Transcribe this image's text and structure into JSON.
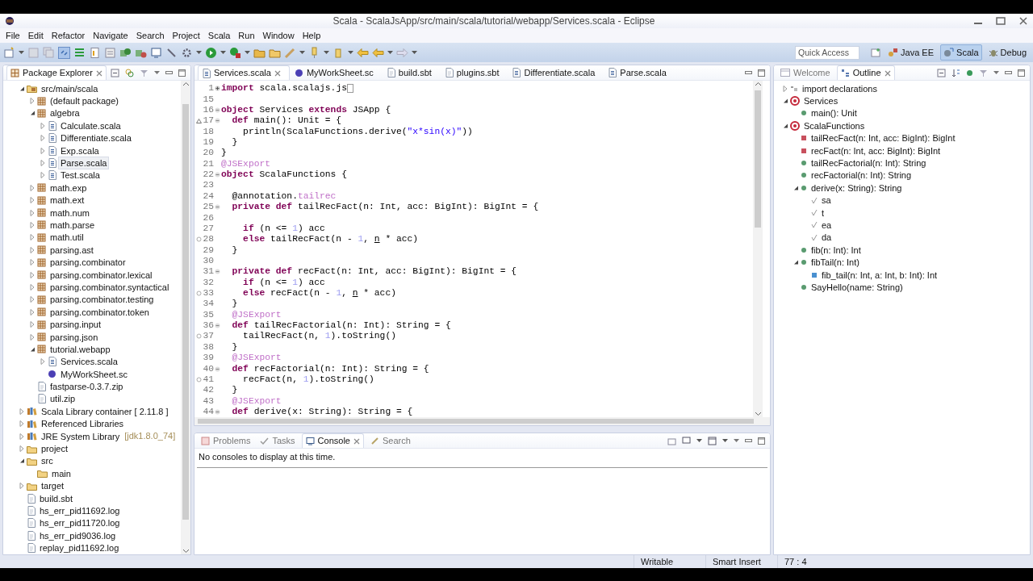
{
  "window": {
    "title": "Scala - ScalaJsApp/src/main/scala/tutorial/webapp/Services.scala - Eclipse"
  },
  "menu": [
    "File",
    "Edit",
    "Refactor",
    "Navigate",
    "Search",
    "Project",
    "Scala",
    "Run",
    "Window",
    "Help"
  ],
  "quick_access": {
    "placeholder": "Quick Access"
  },
  "perspectives": [
    {
      "label": "Java EE",
      "kind": "javaee",
      "selected": false
    },
    {
      "label": "Scala",
      "kind": "scala",
      "selected": true
    },
    {
      "label": "Debug",
      "kind": "debug",
      "selected": false
    }
  ],
  "package_explorer": {
    "title": "Package Explorer",
    "items": [
      {
        "label": "src/main/scala",
        "kind": "source-folder",
        "expanded": true,
        "selected": false,
        "children": [
          {
            "label": "(default package)",
            "kind": "package",
            "expanded": false,
            "selected": false
          },
          {
            "label": "algebra",
            "kind": "package",
            "expanded": true,
            "selected": false,
            "children": [
              {
                "label": "Calculate.scala",
                "kind": "scala-file",
                "expanded": false,
                "selected": false
              },
              {
                "label": "Differentiate.scala",
                "kind": "scala-file",
                "expanded": false,
                "selected": false
              },
              {
                "label": "Exp.scala",
                "kind": "scala-file",
                "expanded": false,
                "selected": false
              },
              {
                "label": "Parse.scala",
                "kind": "scala-file",
                "expanded": false,
                "selected": true
              },
              {
                "label": "Test.scala",
                "kind": "scala-file",
                "expanded": false,
                "selected": false
              }
            ]
          },
          {
            "label": "math.exp",
            "kind": "package",
            "expanded": false,
            "selected": false
          },
          {
            "label": "math.ext",
            "kind": "package",
            "expanded": false,
            "selected": false
          },
          {
            "label": "math.num",
            "kind": "package",
            "expanded": false,
            "selected": false
          },
          {
            "label": "math.parse",
            "kind": "package",
            "expanded": false,
            "selected": false
          },
          {
            "label": "math.util",
            "kind": "package",
            "expanded": false,
            "selected": false
          },
          {
            "label": "parsing.ast",
            "kind": "package",
            "expanded": false,
            "selected": false
          },
          {
            "label": "parsing.combinator",
            "kind": "package",
            "expanded": false,
            "selected": false
          },
          {
            "label": "parsing.combinator.lexical",
            "kind": "package",
            "expanded": false,
            "selected": false
          },
          {
            "label": "parsing.combinator.syntactical",
            "kind": "package",
            "expanded": false,
            "selected": false
          },
          {
            "label": "parsing.combinator.testing",
            "kind": "package",
            "expanded": false,
            "selected": false
          },
          {
            "label": "parsing.combinator.token",
            "kind": "package",
            "expanded": false,
            "selected": false
          },
          {
            "label": "parsing.input",
            "kind": "package",
            "expanded": false,
            "selected": false
          },
          {
            "label": "parsing.json",
            "kind": "package",
            "expanded": false,
            "selected": false
          },
          {
            "label": "tutorial.webapp",
            "kind": "package",
            "expanded": true,
            "selected": false,
            "children": [
              {
                "label": "Services.scala",
                "kind": "scala-file",
                "expanded": false,
                "selected": false
              },
              {
                "label": "MyWorkSheet.sc",
                "kind": "worksheet",
                "selected": false
              }
            ]
          },
          {
            "label": "fastparse-0.3.7.zip",
            "kind": "file",
            "selected": false
          },
          {
            "label": "util.zip",
            "kind": "file",
            "selected": false
          }
        ]
      },
      {
        "label": "Scala Library container [ 2.11.8 ]",
        "kind": "library",
        "expanded": false,
        "selected": false
      },
      {
        "label": "Referenced Libraries",
        "kind": "library",
        "expanded": false,
        "selected": false
      },
      {
        "label": "JRE System Library",
        "detail": "[jdk1.8.0_74]",
        "kind": "library",
        "expanded": false,
        "selected": false
      },
      {
        "label": "project",
        "kind": "folder",
        "expanded": false,
        "selected": false
      },
      {
        "label": "src",
        "kind": "folder",
        "expanded": true,
        "selected": false,
        "children": [
          {
            "label": "main",
            "kind": "folder",
            "selected": false
          }
        ]
      },
      {
        "label": "target",
        "kind": "folder",
        "expanded": false,
        "selected": false
      },
      {
        "label": "build.sbt",
        "kind": "file",
        "selected": false
      },
      {
        "label": "hs_err_pid11692.log",
        "kind": "file",
        "selected": false
      },
      {
        "label": "hs_err_pid11720.log",
        "kind": "file",
        "selected": false
      },
      {
        "label": "hs_err_pid9036.log",
        "kind": "file",
        "selected": false
      },
      {
        "label": "replay_pid11692.log",
        "kind": "file",
        "selected": false
      }
    ]
  },
  "editor": {
    "tabs": [
      {
        "label": "Services.scala",
        "kind": "scala-file",
        "selected": true
      },
      {
        "label": "MyWorkSheet.sc",
        "kind": "worksheet",
        "selected": false
      },
      {
        "label": "build.sbt",
        "kind": "file",
        "selected": false
      },
      {
        "label": "plugins.sbt",
        "kind": "file",
        "selected": false
      },
      {
        "label": "Differentiate.scala",
        "kind": "scala-file",
        "selected": false
      },
      {
        "label": "Parse.scala",
        "kind": "scala-file",
        "selected": false
      }
    ],
    "lines": [
      {
        "number": "1",
        "folded": true,
        "tokens": [
          {
            "kind": "keyword",
            "text": "import"
          },
          {
            "kind": "plain",
            "text": " scala.scalajs.js"
          }
        ]
      },
      {
        "number": "15"
      },
      {
        "number": "16",
        "folded": false,
        "tokens": [
          {
            "kind": "keyword",
            "text": "object"
          },
          {
            "kind": "plain",
            "text": " Services "
          },
          {
            "kind": "keyword",
            "text": "extends"
          },
          {
            "kind": "plain",
            "text": " JSApp {"
          }
        ]
      },
      {
        "number": "17",
        "folded": false,
        "overrides": true,
        "tokens": [
          {
            "kind": "keyword",
            "text": "  def"
          },
          {
            "kind": "plain",
            "text": " main(): Unit = {"
          }
        ]
      },
      {
        "number": "18",
        "tokens": [
          {
            "kind": "plain",
            "text": "    println(ScalaFunctions.derive("
          },
          {
            "kind": "string",
            "text": "\"x*sin(x)\""
          },
          {
            "kind": "plain",
            "text": "))"
          }
        ]
      },
      {
        "number": "19",
        "tokens": [
          {
            "kind": "plain",
            "text": "  }"
          }
        ]
      },
      {
        "number": "20",
        "tokens": [
          {
            "kind": "plain",
            "text": "}"
          }
        ]
      },
      {
        "number": "21",
        "tokens": [
          {
            "kind": "annotation",
            "text": "@JSExport"
          }
        ]
      },
      {
        "number": "22",
        "folded": false,
        "tokens": [
          {
            "kind": "keyword",
            "text": "object"
          },
          {
            "kind": "plain",
            "text": " ScalaFunctions {"
          }
        ]
      },
      {
        "number": "23"
      },
      {
        "number": "24",
        "tokens": [
          {
            "kind": "plain",
            "text": "  @annotation."
          },
          {
            "kind": "annotation",
            "text": "tailrec"
          }
        ]
      },
      {
        "number": "25",
        "folded": false,
        "tokens": [
          {
            "kind": "keyword",
            "text": "  private def"
          },
          {
            "kind": "plain",
            "text": " tailRecFact(n: Int, acc: BigInt): BigInt = {"
          }
        ]
      },
      {
        "number": "26"
      },
      {
        "number": "27",
        "tokens": [
          {
            "kind": "keyword",
            "text": "    if"
          },
          {
            "kind": "plain",
            "text": " (n <= "
          },
          {
            "kind": "number",
            "text": "1"
          },
          {
            "kind": "plain",
            "text": ") acc"
          }
        ]
      },
      {
        "number": "28",
        "recursive_call": true,
        "tokens": [
          {
            "kind": "keyword",
            "text": "    else"
          },
          {
            "kind": "plain",
            "text": " tailRecFact(n - "
          },
          {
            "kind": "number",
            "text": "1"
          },
          {
            "kind": "plain",
            "text": ", "
          },
          {
            "kind": "implicit",
            "text": "n"
          },
          {
            "kind": "plain",
            "text": " * acc)"
          }
        ]
      },
      {
        "number": "29",
        "tokens": [
          {
            "kind": "plain",
            "text": "  }"
          }
        ]
      },
      {
        "number": "30"
      },
      {
        "number": "31",
        "folded": false,
        "tokens": [
          {
            "kind": "keyword",
            "text": "  private def"
          },
          {
            "kind": "plain",
            "text": " recFact(n: Int, acc: BigInt): BigInt = {"
          }
        ]
      },
      {
        "number": "32",
        "tokens": [
          {
            "kind": "keyword",
            "text": "    if"
          },
          {
            "kind": "plain",
            "text": " (n <= "
          },
          {
            "kind": "number",
            "text": "1"
          },
          {
            "kind": "plain",
            "text": ") acc"
          }
        ]
      },
      {
        "number": "33",
        "recursive_call": true,
        "tokens": [
          {
            "kind": "keyword",
            "text": "    else"
          },
          {
            "kind": "plain",
            "text": " recFact(n - "
          },
          {
            "kind": "number",
            "text": "1"
          },
          {
            "kind": "plain",
            "text": ", "
          },
          {
            "kind": "implicit",
            "text": "n"
          },
          {
            "kind": "plain",
            "text": " * acc)"
          }
        ]
      },
      {
        "number": "34",
        "tokens": [
          {
            "kind": "plain",
            "text": "  }"
          }
        ]
      },
      {
        "number": "35",
        "tokens": [
          {
            "kind": "annotation",
            "text": "  @JSExport"
          }
        ]
      },
      {
        "number": "36",
        "folded": false,
        "tokens": [
          {
            "kind": "keyword",
            "text": "  def"
          },
          {
            "kind": "plain",
            "text": " tailRecFactorial(n: Int): String = {"
          }
        ]
      },
      {
        "number": "37",
        "recursive_call": true,
        "tokens": [
          {
            "kind": "plain",
            "text": "    tailRecFact(n, "
          },
          {
            "kind": "number",
            "text": "1"
          },
          {
            "kind": "plain",
            "text": ").toString()"
          }
        ]
      },
      {
        "number": "38",
        "tokens": [
          {
            "kind": "plain",
            "text": "  }"
          }
        ]
      },
      {
        "number": "39",
        "tokens": [
          {
            "kind": "annotation",
            "text": "  @JSExport"
          }
        ]
      },
      {
        "number": "40",
        "folded": false,
        "tokens": [
          {
            "kind": "keyword",
            "text": "  def"
          },
          {
            "kind": "plain",
            "text": " recFactorial(n: Int): String = {"
          }
        ]
      },
      {
        "number": "41",
        "recursive_call": true,
        "tokens": [
          {
            "kind": "plain",
            "text": "    recFact(n, "
          },
          {
            "kind": "number",
            "text": "1"
          },
          {
            "kind": "plain",
            "text": ").toString()"
          }
        ]
      },
      {
        "number": "42",
        "tokens": [
          {
            "kind": "plain",
            "text": "  }"
          }
        ]
      },
      {
        "number": "43",
        "tokens": [
          {
            "kind": "annotation",
            "text": "  @JSExport"
          }
        ]
      },
      {
        "number": "44",
        "folded": false,
        "tokens": [
          {
            "kind": "keyword",
            "text": "  def"
          },
          {
            "kind": "plain",
            "text": " derive(x: String): String = {"
          }
        ]
      }
    ]
  },
  "console": {
    "tabs": [
      {
        "label": "Problems",
        "kind": "problems",
        "selected": false
      },
      {
        "label": "Tasks",
        "kind": "tasks",
        "selected": false
      },
      {
        "label": "Console",
        "kind": "console",
        "selected": true
      },
      {
        "label": "Search",
        "kind": "search",
        "selected": false
      }
    ],
    "message": "No consoles to display at this time."
  },
  "outline": {
    "tabs": [
      {
        "label": "Welcome",
        "kind": "welcome",
        "selected": false
      },
      {
        "label": "Outline",
        "kind": "outline",
        "selected": true
      }
    ],
    "items": [
      {
        "label": "import declarations",
        "kind": "imports",
        "expanded": false,
        "selected": false
      },
      {
        "label": "Services",
        "kind": "object",
        "expanded": true,
        "selected": false,
        "children": [
          {
            "label": "main(): Unit",
            "kind": "public-method",
            "selected": false
          }
        ]
      },
      {
        "label": "ScalaFunctions",
        "kind": "object",
        "expanded": true,
        "selected": false,
        "children": [
          {
            "label": "tailRecFact(n: Int, acc: BigInt): BigInt",
            "kind": "private-method",
            "selected": false
          },
          {
            "label": "recFact(n: Int, acc: BigInt): BigInt",
            "kind": "private-method",
            "selected": false
          },
          {
            "label": "tailRecFactorial(n: Int): String",
            "kind": "public-method",
            "selected": false
          },
          {
            "label": "recFactorial(n: Int): String",
            "kind": "public-method",
            "selected": false
          },
          {
            "label": "derive(x: String): String",
            "kind": "public-method",
            "expanded": true,
            "selected": false,
            "children": [
              {
                "label": "sa",
                "kind": "local-value",
                "selected": false
              },
              {
                "label": "t",
                "kind": "local-value",
                "selected": false
              },
              {
                "label": "ea",
                "kind": "local-value",
                "selected": false
              },
              {
                "label": "da",
                "kind": "local-value",
                "selected": false
              }
            ]
          },
          {
            "label": "fib(n: Int): Int",
            "kind": "public-method",
            "selected": false
          },
          {
            "label": "fibTail(n: Int)",
            "kind": "public-method",
            "expanded": true,
            "selected": false,
            "children": [
              {
                "label": "fib_tail(n: Int, a: Int, b: Int): Int",
                "kind": "local-method",
                "selected": false
              }
            ]
          },
          {
            "label": "SayHello(name: String)",
            "kind": "public-method",
            "selected": false
          }
        ]
      }
    ]
  },
  "status_bar": [
    "Writable",
    "Smart Insert",
    "77 : 4"
  ]
}
